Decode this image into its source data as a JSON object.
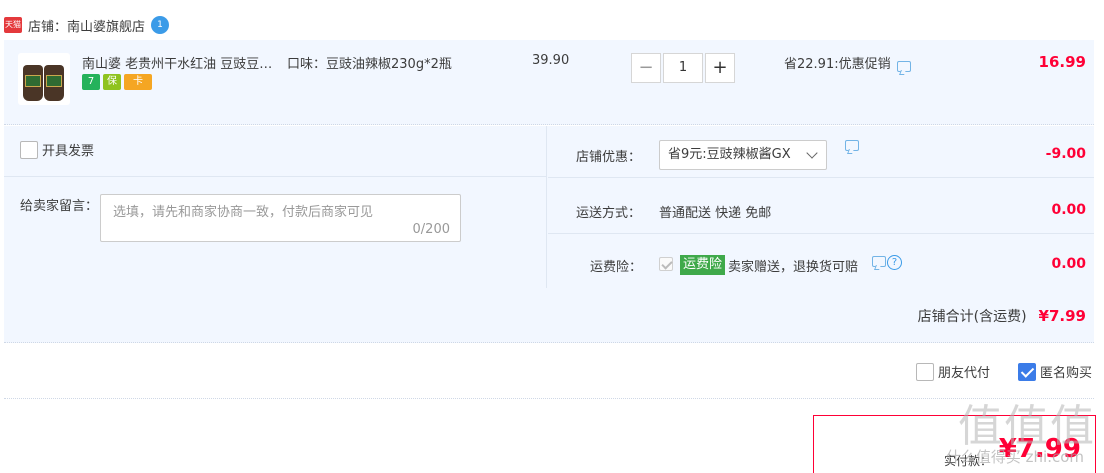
{
  "shop": {
    "badge": "天猫",
    "name": "店铺：南山婆旗舰店",
    "chat_badge": "1"
  },
  "item": {
    "title": "南山婆 老贵州干水红油 豆豉豆…",
    "sku": "口味：豆豉油辣椒230g*2瓶",
    "unit_price": "39.90",
    "quantity": "1",
    "promo": "省22.91:优惠促销",
    "total": "16.99",
    "service_icons": [
      "7",
      "保",
      "卡"
    ]
  },
  "invoice": {
    "label": "开具发票"
  },
  "message": {
    "label": "给卖家留言：",
    "placeholder": "选填，请先和商家协商一致，付款后商家可见",
    "counter": "0/200"
  },
  "discount": {
    "label": "店铺优惠：",
    "selected": "省9元:豆豉辣椒酱GX",
    "value": "-9.00"
  },
  "shipping": {
    "label": "运送方式：",
    "method": "普通配送 快递 免邮",
    "value": "0.00"
  },
  "insurance": {
    "label": "运费险：",
    "tag": "运费险",
    "text": "卖家赠送，退换货可赔",
    "value": "0.00"
  },
  "shop_total": {
    "label": "店铺合计(含运费)",
    "value": "¥7.99"
  },
  "options": {
    "friend_pay": "朋友代付",
    "anonymous": "匿名购买"
  },
  "payment": {
    "label": "实付款：",
    "value": "¥7.99"
  },
  "watermark": {
    "big": "值值值",
    "small": "什么值得买 zhi.com"
  },
  "colors": {
    "accent": "#ff0036",
    "row_bg": "#f2f7ff",
    "link": "#3b9be8"
  }
}
